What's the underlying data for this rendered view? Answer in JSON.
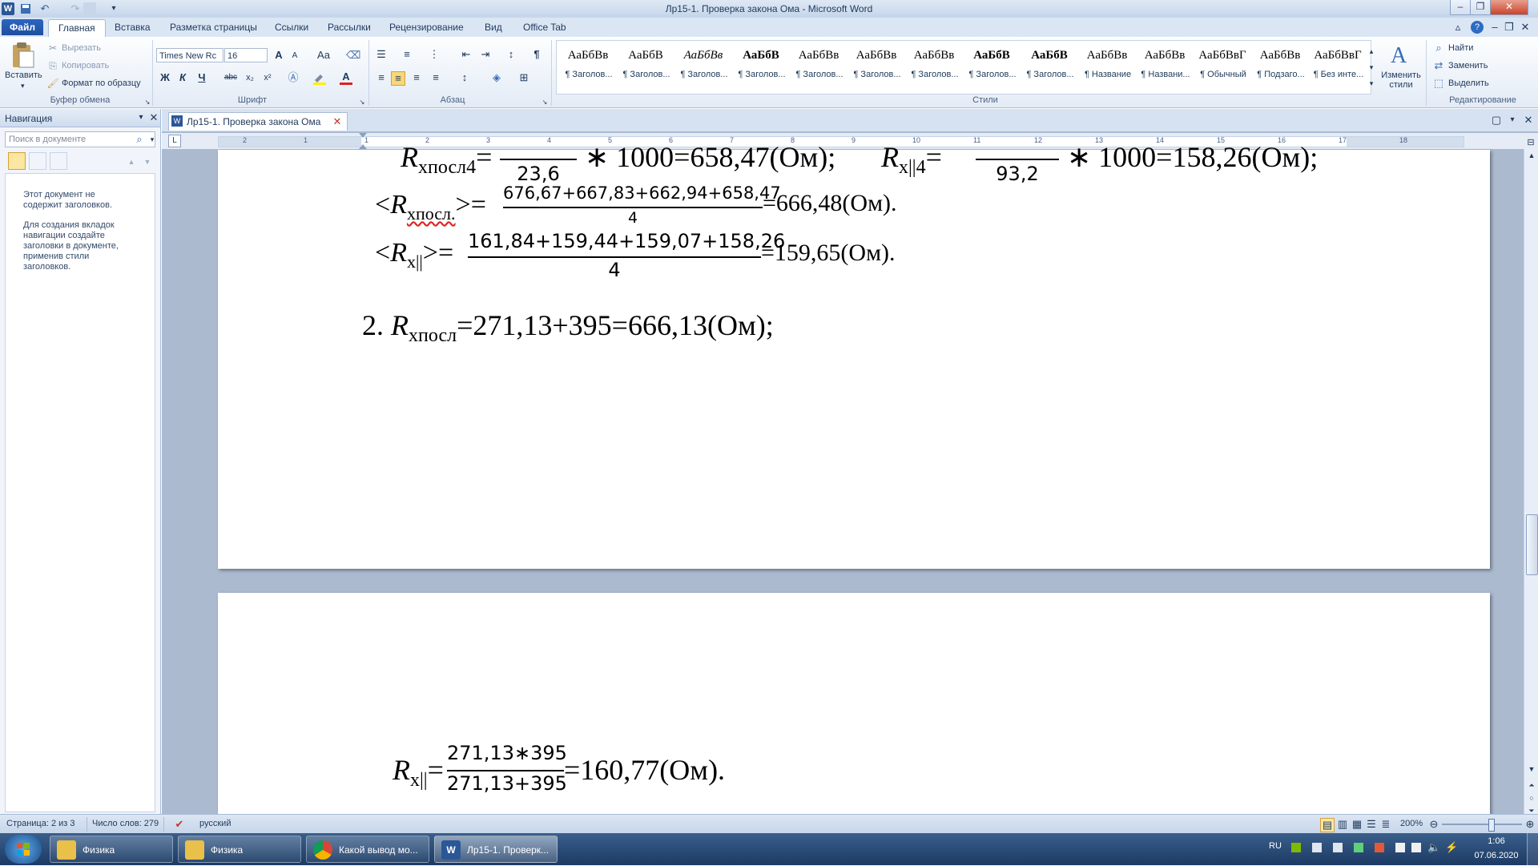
{
  "window": {
    "title": "Лр15-1. Проверка закона Ома  -  Microsoft Word",
    "app_icon": "W"
  },
  "tabs": [
    "Файл",
    "Главная",
    "Вставка",
    "Разметка страницы",
    "Ссылки",
    "Рассылки",
    "Рецензирование",
    "Вид",
    "Office Tab"
  ],
  "clipboard": {
    "paste": "Вставить",
    "cut": "Вырезать",
    "copy": "Копировать",
    "format_painter": "Формат по образцу",
    "group": "Буфер обмена"
  },
  "font": {
    "name": "Times New Rc",
    "size": "16",
    "group": "Шрифт",
    "bold": "Ж",
    "italic": "К",
    "underline": "Ч",
    "strike": "abc",
    "sub": "x₂",
    "sup": "x²",
    "grow": "A",
    "shrink": "A",
    "case": "Aa",
    "color_a": "A"
  },
  "paragraph": {
    "group": "Абзац",
    "pilcrow": "¶"
  },
  "styles": {
    "group": "Стили",
    "items": [
      {
        "sample": "АаБбВв",
        "name": "¶ Заголов..."
      },
      {
        "sample": "АаБбВ",
        "name": "¶ Заголов..."
      },
      {
        "sample": "АаБбВв",
        "name": "¶ Заголов..."
      },
      {
        "sample": "АаБбВ",
        "name": "¶ Заголов..."
      },
      {
        "sample": "АаБбВв",
        "name": "¶ Заголов..."
      },
      {
        "sample": "АаБбВв",
        "name": "¶ Заголов..."
      },
      {
        "sample": "АаБбВв",
        "name": "¶ Заголов..."
      },
      {
        "sample": "АаБбВ",
        "name": "¶ Заголов..."
      },
      {
        "sample": "АаБбВ",
        "name": "¶ Заголов..."
      },
      {
        "sample": "АаБбВв",
        "name": "¶ Название"
      },
      {
        "sample": "АаБбВв",
        "name": "¶ Названи..."
      },
      {
        "sample": "АаБбВвГ",
        "name": "¶ Обычный"
      },
      {
        "sample": "АаБбВв",
        "name": "¶ Подзаго..."
      },
      {
        "sample": "АаБбВвГ",
        "name": "¶ Без инте..."
      }
    ],
    "change_styles": "Изменить стили"
  },
  "editing": {
    "group": "Редактирование",
    "find": "Найти",
    "replace": "Заменить",
    "select": "Выделить"
  },
  "nav": {
    "title": "Навигация",
    "search_placeholder": "Поиск в документе",
    "msg1": "Этот документ не содержит заголовков.",
    "msg2": "Для создания вкладок навигации создайте заголовки в документе, применив стили заголовков."
  },
  "doc_tab": {
    "label": "Лр15-1. Проверка закона Ома"
  },
  "ruler": {
    "numbers": [
      "2",
      "1",
      "1",
      "2",
      "3",
      "4",
      "5",
      "6",
      "7",
      "8",
      "9",
      "10",
      "11",
      "12",
      "13",
      "14",
      "15",
      "16",
      "17",
      "18"
    ]
  },
  "page1": {
    "line1_left_R": "R",
    "line1_left_sub": "xпосл4",
    "line1_left_den": "23,6",
    "line1_left_rest": "∗ 1000=658,47(Ом);",
    "line1_right_R": "R",
    "line1_right_sub": "x||4",
    "line1_right_den": "93,2",
    "line1_right_rest": "∗ 1000=158,26(Ом);",
    "avg1_left": "<",
    "avg1_R": "R",
    "avg1_sub": "xпосл.",
    "avg1_close": ">=",
    "avg1_num": "676,67+667,83+662,94+658,47",
    "avg1_den": "4",
    "avg1_result": "=666,48(Ом).",
    "avg2_left": "<",
    "avg2_R": "R",
    "avg2_sub": "x||",
    "avg2_close": ">=",
    "avg2_num": "161,84+159,44+159,07+158,26",
    "avg2_den": "4",
    "avg2_result": "=159,65(Ом).",
    "item2_num": "2.",
    "item2_R": "R",
    "item2_sub": "xпосл",
    "item2_rest": "=271,13+395=666,13(Ом);"
  },
  "page2": {
    "R": "R",
    "sub": "x||",
    "eq": "=",
    "num": "271,13∗395",
    "den": "271,13+395",
    "result": "=160,77(Ом)."
  },
  "status": {
    "page": "Страница: 2 из 3",
    "words": "Число слов: 279",
    "lang": "русский",
    "zoom": "200%"
  },
  "taskbar": {
    "items": [
      "Физика",
      "Физика",
      "Какой вывод мо...",
      "Лр15-1. Проверк..."
    ],
    "lang": "RU",
    "time": "1:06",
    "date": "07.06.2020"
  }
}
